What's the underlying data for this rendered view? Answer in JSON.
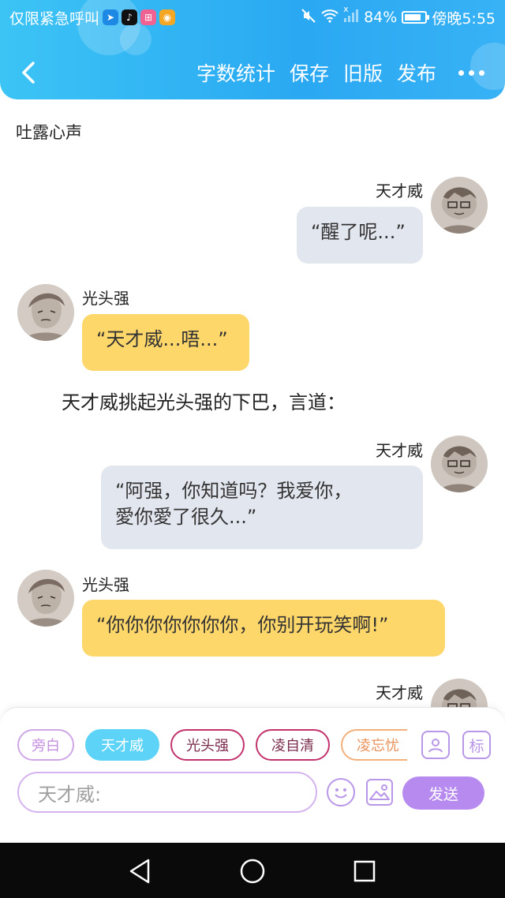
{
  "status_bar": {
    "carrier_text": "仅限紧急呼叫",
    "battery": "84%",
    "battery_level": 0.84,
    "time": "傍晚5:55",
    "signal_mark": "x"
  },
  "toolbar": {
    "word_count": "字数统计",
    "save": "保存",
    "old_version": "旧版",
    "publish": "发布"
  },
  "section_title": "吐露心声",
  "messages": [
    {
      "speaker": "天才威",
      "text": "“醒了呢...”",
      "side": "right"
    },
    {
      "speaker": "光头强",
      "text": "“天才威...唔...”",
      "side": "left"
    },
    {
      "speaker": "天才威",
      "text_line1": "“阿强，你知道吗？我爱你，",
      "text_line2": "愛你愛了很久...”",
      "side": "right"
    },
    {
      "speaker": "光头强",
      "text": "“你你你你你你你，你别开玩笑啊!”",
      "side": "left"
    },
    {
      "speaker": "天才威",
      "side": "right"
    }
  ],
  "narration": "天才威挑起光头强的下巴，言道：",
  "roles": [
    "旁白",
    "天才威",
    "光头强",
    "凌自清",
    "凌忘忧"
  ],
  "selected_role": "天才威",
  "input": {
    "placeholder": "天才威:"
  },
  "tag_label": "标",
  "send_label": "发送",
  "colors": {
    "header": "#2aa8f2",
    "selected_role_bg": "#5dd4f7",
    "send_bg": "#b78af0",
    "bubble_gray": "#e2e6ee",
    "bubble_yellow": "#fdd76a"
  }
}
